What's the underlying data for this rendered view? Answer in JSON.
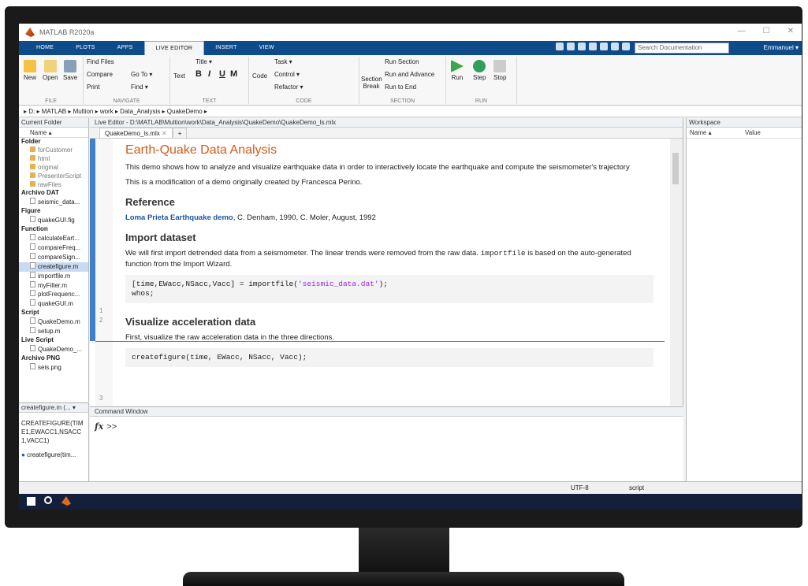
{
  "window": {
    "title": "MATLAB R2020a"
  },
  "tabs": [
    "HOME",
    "PLOTS",
    "APPS",
    "LIVE EDITOR",
    "INSERT",
    "VIEW"
  ],
  "active_tab": "LIVE EDITOR",
  "search": {
    "placeholder": "Search Documentation"
  },
  "user": "Emmanuel ▾",
  "ribbon": {
    "file": {
      "label": "FILE",
      "new": "New",
      "open": "Open",
      "save": "Save"
    },
    "navigate": {
      "label": "NAVIGATE",
      "find_files": "Find Files",
      "compare": "Compare",
      "print": "Print",
      "goto": "Go To ▾",
      "find": "Find ▾"
    },
    "text": {
      "label": "TEXT",
      "text": "Text",
      "title": "Title ▾",
      "bold": "B",
      "italic": "I",
      "underline": "U",
      "mono": "M"
    },
    "code": {
      "label": "CODE",
      "code": "Code",
      "task": "Task ▾",
      "control": "Control ▾",
      "refactor": "Refactor ▾"
    },
    "section": {
      "label": "SECTION",
      "section_break": "Section Break",
      "run_section": "Run Section",
      "run_advance": "Run and Advance",
      "run_end": "Run to End"
    },
    "run": {
      "label": "RUN",
      "run": "Run",
      "step": "Step",
      "stop": "Stop"
    }
  },
  "path": "▸ D: ▸ MATLAB ▸ Multion ▸ work ▸ Data_Analysis ▸ QuakeDemo ▸",
  "current_folder": {
    "header": "Current Folder",
    "name_col": "Name ▴",
    "groups": [
      {
        "name": "Folder",
        "items": [
          "forCustomer",
          "html",
          "original",
          "PresenterScript",
          "rawFiles"
        ]
      },
      {
        "name": "Archivo DAT",
        "items": [
          "seismic_data..."
        ]
      },
      {
        "name": "Figure",
        "items": [
          "quakeGUI.fig"
        ]
      },
      {
        "name": "Function",
        "items": [
          "calculateEart...",
          "compareFreq...",
          "compareSign...",
          "createfigure.m",
          "importfile.m",
          "myFilter.m",
          "plotFrequenc...",
          "quakeGUI.m"
        ]
      },
      {
        "name": "Script",
        "items": [
          "QuakeDemo.m",
          "setup.m"
        ]
      },
      {
        "name": "Live Script",
        "items": [
          "QuakeDemo_..."
        ]
      },
      {
        "name": "Archivo PNG",
        "items": [
          "seis.png"
        ]
      }
    ],
    "selected": "createfigure.m"
  },
  "detail": {
    "file": "createfigure.m (... ▾",
    "signature": "CREATEFIGURE(TIME1,EWACC1,NSACC1,VACC1)",
    "link": "createfigure(tim..."
  },
  "editor": {
    "header": "Live Editor - D:\\MATLAB\\Multion\\work\\Data_Analysis\\QuakeDemo\\QuakeDemo_ls.mlx",
    "tab": "QuakeDemo_ls.mlx",
    "title": "Earth-Quake Data Analysis",
    "intro": "This demo shows how to analyze and visualize earthquake data in order to interactively locate the earthquake and compute the seismometer's trajectory",
    "modification": "This is a modification of a demo originally created by Francesca Perino.",
    "reference_heading": "Reference",
    "reference_link": "Loma Prieta Earthquake demo",
    "reference_rest": ", C. Denham, 1990, C. Moler, August, 1992",
    "import_heading": "Import dataset",
    "import_text_1": "We will first import detrended data from a seismometer. The linear trends were removed from the raw data.",
    "import_code_word": "importfile",
    "import_text_2": "is based on the auto-generated function from the Import Wizard.",
    "code_line1_a": "[time,EWacc,NSacc,Vacc] = importfile(",
    "code_line1_str": "'seismic_data.dat'",
    "code_line1_b": ");",
    "code_line2": "whos;",
    "visualize_heading": "Visualize acceleration data",
    "visualize_text": "First, visualize the raw acceleration data in the three directions.",
    "code_line3": "createfigure(time, EWacc, NSacc, Vacc);",
    "line_numbers": [
      "1",
      "2",
      "3"
    ]
  },
  "workspace": {
    "header": "Workspace",
    "name_col": "Name ▴",
    "value_col": "Value"
  },
  "command_window": {
    "header": "Command Window",
    "fx": "fx",
    "prompt": ">>"
  },
  "status": {
    "encoding": "UTF-8",
    "type": "script"
  },
  "colors": {
    "accent": "#0e4b8a",
    "title_orange": "#d05d1a",
    "link": "#1b55a3"
  }
}
